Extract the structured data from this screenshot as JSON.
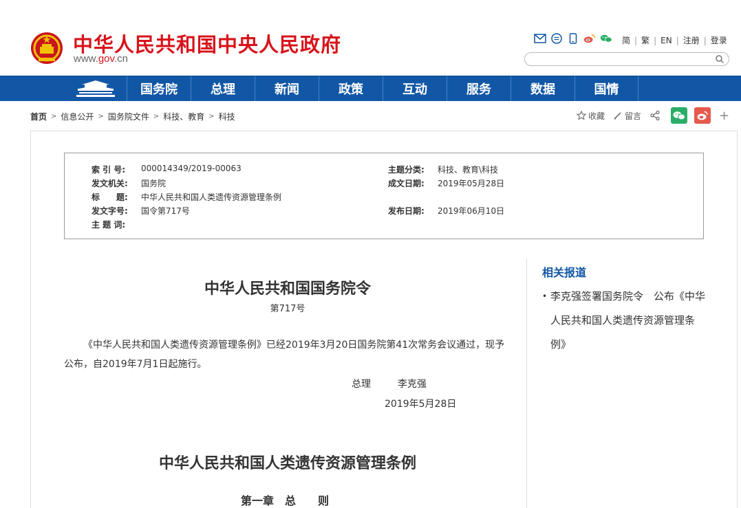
{
  "header": {
    "site_title": "中华人民共和国中央人民政府",
    "site_url_prefix": "www.",
    "site_url_red": "gov",
    "site_url_suffix": ".cn",
    "links": [
      "简",
      "繁",
      "EN",
      "注册",
      "登录"
    ],
    "search_placeholder": ""
  },
  "nav": {
    "items": [
      "国务院",
      "总理",
      "新闻",
      "政策",
      "互动",
      "服务",
      "数据",
      "国情"
    ]
  },
  "breadcrumb": [
    "首页",
    "信息公开",
    "国务院文件",
    "科技、教育",
    "科技"
  ],
  "tools": {
    "favorite": "收藏",
    "comment": "留言",
    "plus": "+"
  },
  "info": {
    "index_label": "索 引 号:",
    "index_value": "000014349/2019-00063",
    "topic_label": "主题分类:",
    "topic_value": "科技、教育\\科技",
    "issuer_label": "发文机关:",
    "issuer_value": "国务院",
    "created_label": "成文日期:",
    "created_value": "2019年05月28日",
    "title_label": "标　　题:",
    "title_value": "中华人民共和国人类遗传资源管理条例",
    "docno_label": "发文字号:",
    "docno_value": "国令第717号",
    "published_label": "发布日期:",
    "published_value": "2019年06月10日",
    "keywords_label": "主 题 词:",
    "keywords_value": ""
  },
  "document": {
    "title": "中华人民共和国国务院令",
    "number": "第717号",
    "paragraph": "《中华人民共和国人类遗传资源管理条例》已经2019年3月20日国务院第41次常务会议通过，现予公布，自2019年7月1日起施行。",
    "sign_role": "总理",
    "sign_name": "李克强",
    "sign_date": "2019年5月28日",
    "law_title": "中华人民共和国人类遗传资源管理条例",
    "chapter": "第一章　总　　则"
  },
  "related": {
    "title": "相关报道",
    "items": [
      "李克强签署国务院令　公布《中华人民共和国人类遗传资源管理条例》"
    ]
  },
  "colors": {
    "brand_red": "#d8141b",
    "nav_blue": "#1157a6",
    "wechat_green": "#2aae67",
    "weibo_red": "#e6594c"
  }
}
